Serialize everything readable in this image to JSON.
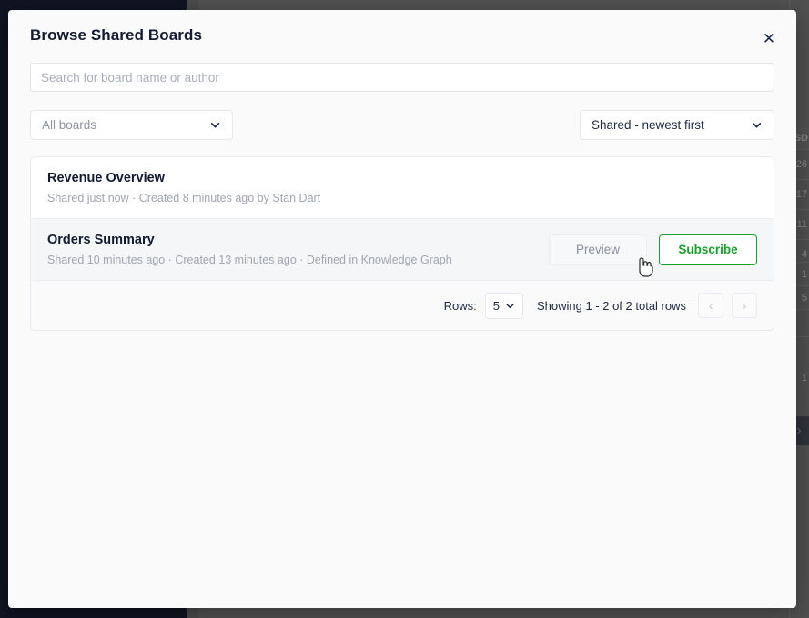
{
  "modal": {
    "title": "Browse Shared Boards",
    "close_icon": "close-icon",
    "search": {
      "placeholder": "Search for board name or author",
      "value": ""
    },
    "filter_select": {
      "value": "All boards",
      "chevron_icon": "chevron-down-icon"
    },
    "sort_select": {
      "value": "Shared - newest first",
      "chevron_icon": "chevron-down-icon"
    },
    "boards": [
      {
        "name": "Revenue Overview",
        "meta": "Shared just now  ·  Created 8 minutes ago by Stan Dart",
        "actions": []
      },
      {
        "name": "Orders Summary",
        "meta": "Shared 10 minutes ago  ·  Created 13 minutes ago  ·  Defined in Knowledge Graph",
        "actions": [
          {
            "label": "Preview",
            "style": "secondary"
          },
          {
            "label": "Subscribe",
            "style": "outline-green"
          }
        ]
      }
    ],
    "pagination": {
      "rows_label": "Rows:",
      "rows_value": "5",
      "rows_chevron_icon": "chevron-down-icon",
      "status": "Showing 1 - 2 of 2 total rows",
      "prev_label": "‹",
      "next_label": "›"
    }
  },
  "background": {
    "table": {
      "header": "SD",
      "cells": [
        "26",
        "17",
        "11",
        "4",
        "1",
        "5",
        "",
        "",
        "1"
      ]
    },
    "pager_next_icon": "chevron-right-icon"
  },
  "colors": {
    "sidebar": "#050a24",
    "overlay_dim": "rgba(30,30,30,0.45)",
    "accent_green": "#16a22b",
    "title_navy": "#131a33",
    "muted_text": "#a0a5b2"
  },
  "cursor": {
    "icon": "pointing-hand-cursor"
  }
}
